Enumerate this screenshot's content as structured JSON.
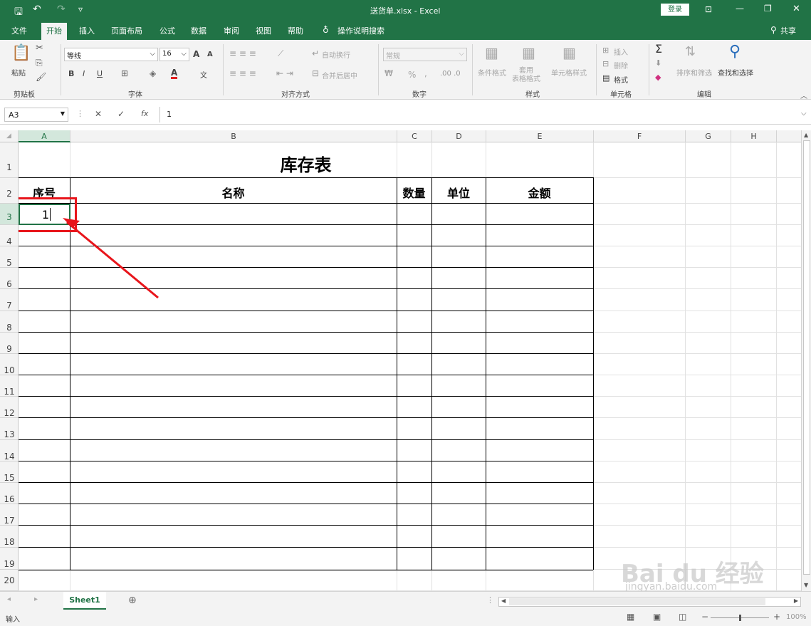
{
  "titlebar": {
    "title": "送货单.xlsx - Excel",
    "login": "登录",
    "save": "🖫",
    "undo": "↶",
    "redo": "↷",
    "customize": "▿",
    "ribbon_display": "⊡",
    "minimize": "—",
    "restore": "❐",
    "close": "✕"
  },
  "tabs": [
    "文件",
    "开始",
    "插入",
    "页面布局",
    "公式",
    "数据",
    "审阅",
    "视图",
    "帮助"
  ],
  "tell_me": "操作说明搜索",
  "share": "共享",
  "ribbon": {
    "clipboard": {
      "paste": "粘贴",
      "label": "剪贴板"
    },
    "font": {
      "name": "等线",
      "size": "16",
      "bold": "B",
      "italic": "I",
      "underline": "U",
      "grow": "A",
      "shrink": "A",
      "color": "A",
      "phonetic": "文",
      "label": "字体"
    },
    "alignment": {
      "wrap": "自动换行",
      "merge": "合并后居中",
      "label": "对齐方式"
    },
    "number": {
      "format": "常规",
      "percent": "%",
      "comma": ",",
      "label": "数字"
    },
    "styles": {
      "conditional": "条件格式",
      "table": "套用\n表格格式",
      "cell": "单元格样式",
      "label": "样式"
    },
    "cells": {
      "insert": "插入",
      "delete": "删除",
      "format": "格式",
      "label": "单元格"
    },
    "editing": {
      "sum": "Σ",
      "sort": "排序和筛选",
      "find": "查找和选择",
      "label": "编辑"
    }
  },
  "formula_bar": {
    "name_box": "A3",
    "cancel": "✕",
    "enter": "✓",
    "fx": "fx",
    "value": "1"
  },
  "columns": [
    "A",
    "B",
    "C",
    "D",
    "E",
    "F",
    "G",
    "H"
  ],
  "rows": [
    "1",
    "2",
    "3",
    "4",
    "5",
    "6",
    "7",
    "8",
    "9",
    "10",
    "11",
    "12",
    "13",
    "14",
    "15",
    "16",
    "17",
    "18",
    "19",
    "20"
  ],
  "sheet": {
    "title": "库存表",
    "headers": [
      "序号",
      "名称",
      "数量",
      "单位",
      "金额"
    ],
    "a3_value": "1"
  },
  "sheet_tabs": [
    "Sheet1"
  ],
  "status": {
    "mode": "输入",
    "zoom": "100%"
  },
  "watermark": {
    "text": "Bai du 经验",
    "sub": "jingyan.baidu.com"
  }
}
